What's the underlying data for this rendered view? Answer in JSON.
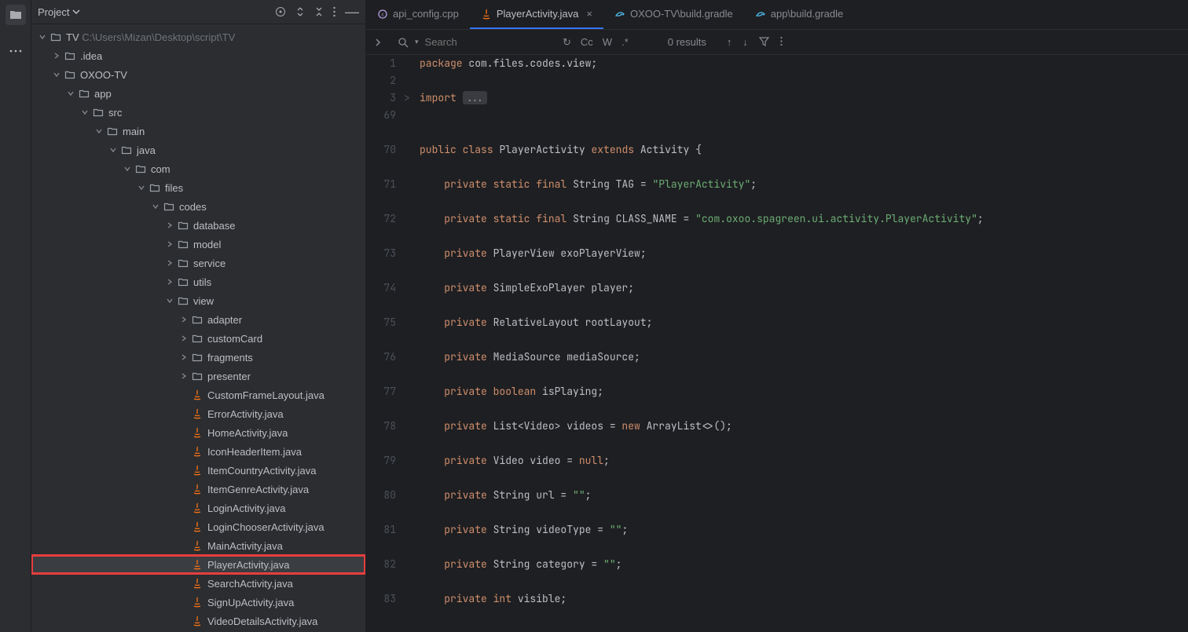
{
  "panel": {
    "title": "Project",
    "actions": [
      "select-opened",
      "expand-all",
      "collapse-all",
      "more",
      "hide"
    ]
  },
  "tree": {
    "root_name": "TV",
    "root_path": "C:\\Users\\Mizan\\Desktop\\script\\TV",
    "items": [
      {
        "indent": 1,
        "arrow": "right",
        "icon": "folder",
        "label": ".idea"
      },
      {
        "indent": 1,
        "arrow": "down",
        "icon": "folder",
        "label": "OXOO-TV"
      },
      {
        "indent": 2,
        "arrow": "down",
        "icon": "folder",
        "label": "app"
      },
      {
        "indent": 3,
        "arrow": "down",
        "icon": "folder",
        "label": "src"
      },
      {
        "indent": 4,
        "arrow": "down",
        "icon": "folder",
        "label": "main"
      },
      {
        "indent": 5,
        "arrow": "down",
        "icon": "folder",
        "label": "java"
      },
      {
        "indent": 6,
        "arrow": "down",
        "icon": "folder",
        "label": "com"
      },
      {
        "indent": 7,
        "arrow": "down",
        "icon": "folder",
        "label": "files"
      },
      {
        "indent": 8,
        "arrow": "down",
        "icon": "folder",
        "label": "codes"
      },
      {
        "indent": 9,
        "arrow": "right",
        "icon": "folder",
        "label": "database"
      },
      {
        "indent": 9,
        "arrow": "right",
        "icon": "folder",
        "label": "model"
      },
      {
        "indent": 9,
        "arrow": "right",
        "icon": "folder",
        "label": "service"
      },
      {
        "indent": 9,
        "arrow": "right",
        "icon": "folder",
        "label": "utils"
      },
      {
        "indent": 9,
        "arrow": "down",
        "icon": "folder",
        "label": "view"
      },
      {
        "indent": 10,
        "arrow": "right",
        "icon": "folder",
        "label": "adapter"
      },
      {
        "indent": 10,
        "arrow": "right",
        "icon": "folder",
        "label": "customCard"
      },
      {
        "indent": 10,
        "arrow": "right",
        "icon": "folder",
        "label": "fragments"
      },
      {
        "indent": 10,
        "arrow": "right",
        "icon": "folder",
        "label": "presenter"
      },
      {
        "indent": 10,
        "arrow": "",
        "icon": "java",
        "label": "CustomFrameLayout.java"
      },
      {
        "indent": 10,
        "arrow": "",
        "icon": "java",
        "label": "ErrorActivity.java"
      },
      {
        "indent": 10,
        "arrow": "",
        "icon": "java",
        "label": "HomeActivity.java"
      },
      {
        "indent": 10,
        "arrow": "",
        "icon": "java",
        "label": "IconHeaderItem.java"
      },
      {
        "indent": 10,
        "arrow": "",
        "icon": "java",
        "label": "ItemCountryActivity.java"
      },
      {
        "indent": 10,
        "arrow": "",
        "icon": "java",
        "label": "ItemGenreActivity.java"
      },
      {
        "indent": 10,
        "arrow": "",
        "icon": "java",
        "label": "LoginActivity.java"
      },
      {
        "indent": 10,
        "arrow": "",
        "icon": "java",
        "label": "LoginChooserActivity.java"
      },
      {
        "indent": 10,
        "arrow": "",
        "icon": "java",
        "label": "MainActivity.java"
      },
      {
        "indent": 10,
        "arrow": "",
        "icon": "java",
        "label": "PlayerActivity.java",
        "selected": true,
        "highlighted": true
      },
      {
        "indent": 10,
        "arrow": "",
        "icon": "java",
        "label": "SearchActivity.java"
      },
      {
        "indent": 10,
        "arrow": "",
        "icon": "java",
        "label": "SignUpActivity.java"
      },
      {
        "indent": 10,
        "arrow": "",
        "icon": "java",
        "label": "VideoDetailsActivity.java"
      }
    ]
  },
  "tabs": [
    {
      "icon": "cpp",
      "label": "api_config.cpp",
      "active": false
    },
    {
      "icon": "java",
      "label": "PlayerActivity.java",
      "active": true,
      "close": true
    },
    {
      "icon": "gradle",
      "label": "OXOO-TV\\build.gradle",
      "active": false
    },
    {
      "icon": "gradle",
      "label": "app\\build.gradle",
      "active": false
    }
  ],
  "search": {
    "placeholder": "Search",
    "opts": [
      "↻",
      "Cc",
      "W",
      ".*"
    ],
    "results": "0 results"
  },
  "code": {
    "lines": [
      {
        "n": "1",
        "html": "<span class='kw'>package</span> com.files.codes.view;"
      },
      {
        "n": "2",
        "html": ""
      },
      {
        "n": "3",
        "fold": ">",
        "html": "<span class='kw'>import</span> <span class='fold-box'>...</span>"
      },
      {
        "n": "69",
        "html": ""
      },
      {
        "n": "",
        "html": ""
      },
      {
        "n": "70",
        "html": "<span class='kw'>public</span> <span class='kw'>class</span> PlayerActivity <span class='kw'>extends</span> Activity {"
      },
      {
        "n": "",
        "html": ""
      },
      {
        "n": "71",
        "html": "    <span class='kw'>private</span> <span class='kw'>static</span> <span class='kw'>final</span> String TAG = <span class='str'>\"PlayerActivity\"</span>;"
      },
      {
        "n": "",
        "html": ""
      },
      {
        "n": "72",
        "html": "    <span class='kw'>private</span> <span class='kw'>static</span> <span class='kw'>final</span> String CLASS_NAME = <span class='str'>\"com.oxoo.spagreen.ui.activity.PlayerActivity\"</span>;"
      },
      {
        "n": "",
        "html": ""
      },
      {
        "n": "73",
        "html": "    <span class='kw'>private</span> PlayerView exoPlayerView;"
      },
      {
        "n": "",
        "html": ""
      },
      {
        "n": "74",
        "html": "    <span class='kw'>private</span> SimpleExoPlayer player;"
      },
      {
        "n": "",
        "html": ""
      },
      {
        "n": "75",
        "html": "    <span class='kw'>private</span> RelativeLayout rootLayout;"
      },
      {
        "n": "",
        "html": ""
      },
      {
        "n": "76",
        "html": "    <span class='kw'>private</span> MediaSource mediaSource;"
      },
      {
        "n": "",
        "html": ""
      },
      {
        "n": "77",
        "html": "    <span class='kw'>private</span> <span class='kw'>boolean</span> isPlaying;"
      },
      {
        "n": "",
        "html": ""
      },
      {
        "n": "78",
        "html": "    <span class='kw'>private</span> List&lt;Video&gt; videos = <span class='kw'>new</span> ArrayList&lt;&gt;();"
      },
      {
        "n": "",
        "html": ""
      },
      {
        "n": "79",
        "html": "    <span class='kw'>private</span> Video video = <span class='kw'>null</span>;"
      },
      {
        "n": "",
        "html": ""
      },
      {
        "n": "80",
        "html": "    <span class='kw'>private</span> String url = <span class='str'>\"\"</span>;"
      },
      {
        "n": "",
        "html": ""
      },
      {
        "n": "81",
        "html": "    <span class='kw'>private</span> String videoType = <span class='str'>\"\"</span>;"
      },
      {
        "n": "",
        "html": ""
      },
      {
        "n": "82",
        "html": "    <span class='kw'>private</span> String category = <span class='str'>\"\"</span>;"
      },
      {
        "n": "",
        "html": ""
      },
      {
        "n": "83",
        "html": "    <span class='kw'>private</span> <span class='kw'>int</span> visible;"
      }
    ]
  }
}
